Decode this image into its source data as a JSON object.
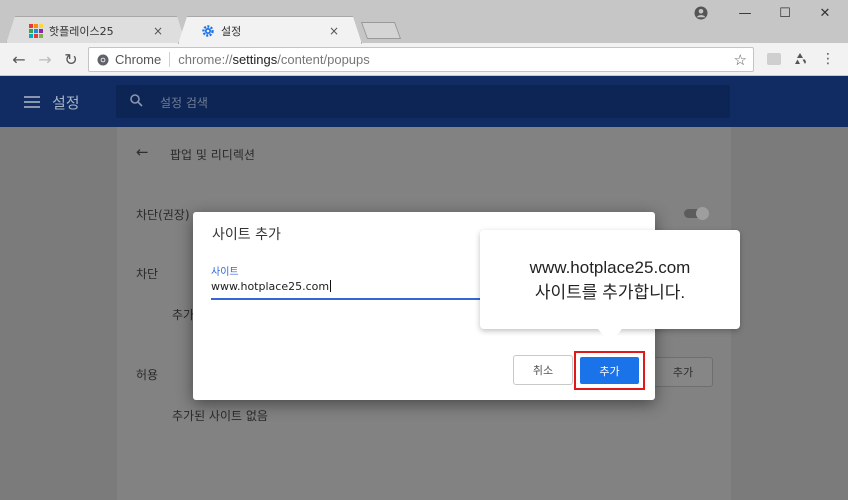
{
  "browser": {
    "tabs": [
      {
        "label": "핫플레이스25",
        "close": "×",
        "icon": "hotplace-favicon"
      },
      {
        "label": "설정",
        "close": "×",
        "icon": "settings-gear-icon"
      }
    ],
    "window_buttons": {
      "profile": "●",
      "minimize": "—",
      "maximize": "☐",
      "close": "✕"
    },
    "nav": {
      "back": "←",
      "forward": "→",
      "reload": "↻"
    },
    "omnibox": {
      "site_label": "Chrome",
      "url_scheme": "chrome://",
      "url_host": "settings",
      "url_path": "/content/popups",
      "star": "☆"
    },
    "menu": "⋮"
  },
  "settings_header": {
    "title": "설정",
    "search_placeholder": "설정 검색"
  },
  "page": {
    "back_arrow": "←",
    "section_title": "팝업 및 리디렉션",
    "blocked_recommended": "차단(권장)",
    "block_label": "차단",
    "block_sub": "추가",
    "allow_label": "허용",
    "allow_add": "추가",
    "allow_empty": "추가된 사이트 없음"
  },
  "dialog": {
    "title": "사이트 추가",
    "field_label": "사이트",
    "field_value": "www.hotplace25.com",
    "cancel": "취소",
    "add": "추가"
  },
  "callout": {
    "line1": "www.hotplace25.com",
    "line2": "사이트를 추가합니다."
  },
  "colors": {
    "header_bg": "#102c62",
    "accent_blue": "#1a73e8",
    "highlight_red": "#e01919"
  }
}
